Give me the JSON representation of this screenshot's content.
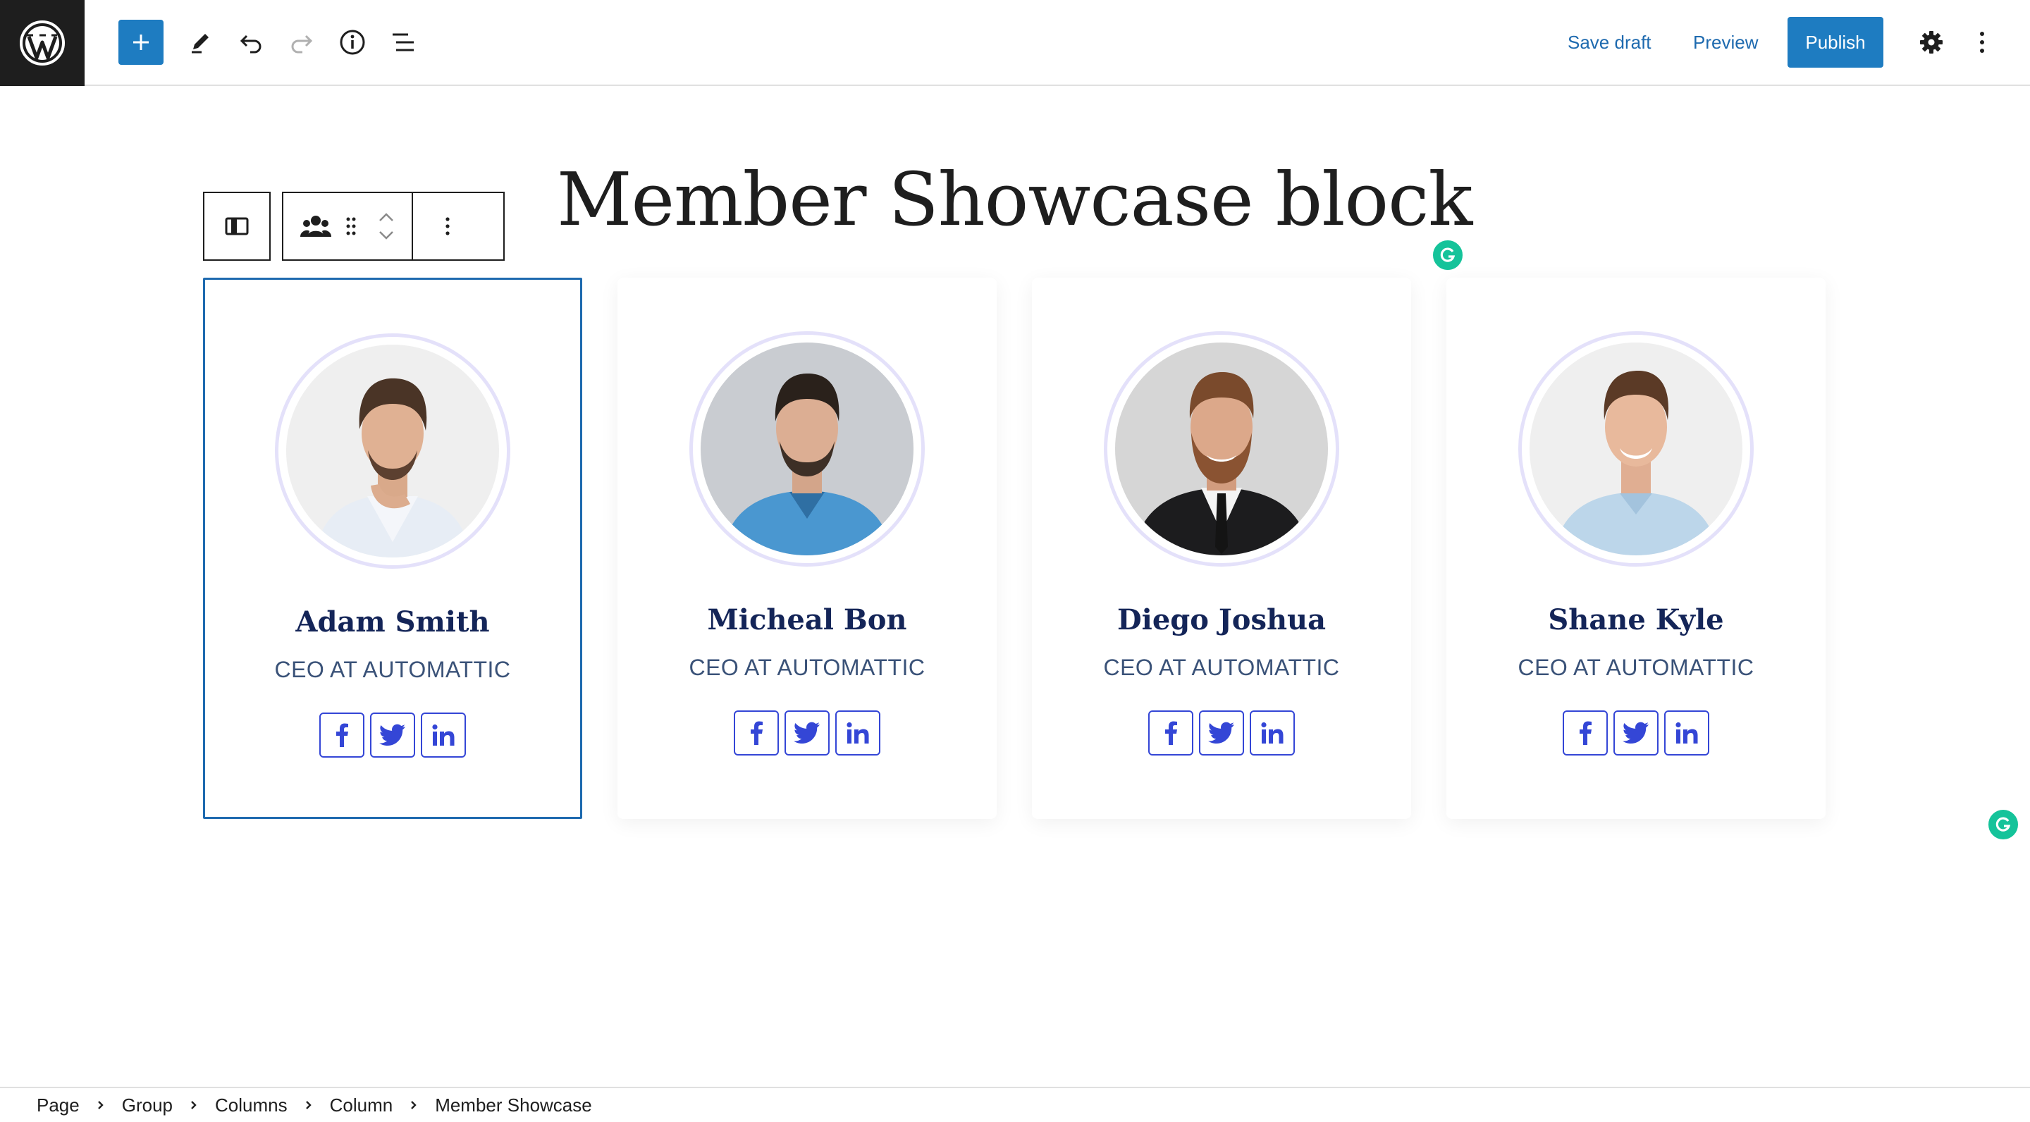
{
  "topbar": {
    "save_draft": "Save draft",
    "preview": "Preview",
    "publish": "Publish",
    "accent": "#1e7cc1"
  },
  "editor": {
    "title": "Member Showcase block"
  },
  "members": [
    {
      "name": "Adam Smith",
      "role": "CEO AT AUTOMATTIC",
      "selected": true
    },
    {
      "name": "Micheal Bon",
      "role": "CEO AT AUTOMATTIC",
      "selected": false
    },
    {
      "name": "Diego Joshua",
      "role": "CEO AT AUTOMATTIC",
      "selected": false
    },
    {
      "name": "Shane Kyle",
      "role": "CEO AT AUTOMATTIC",
      "selected": false
    }
  ],
  "socials": [
    "facebook-icon",
    "twitter-icon",
    "linkedin-icon"
  ],
  "breadcrumb": [
    "Page",
    "Group",
    "Columns",
    "Column",
    "Member Showcase"
  ],
  "colors": {
    "name": "#142558",
    "role": "#3a5278",
    "social_border": "#3446d6",
    "ring": "#e4e1fa",
    "grammarly": "#15c39a"
  }
}
